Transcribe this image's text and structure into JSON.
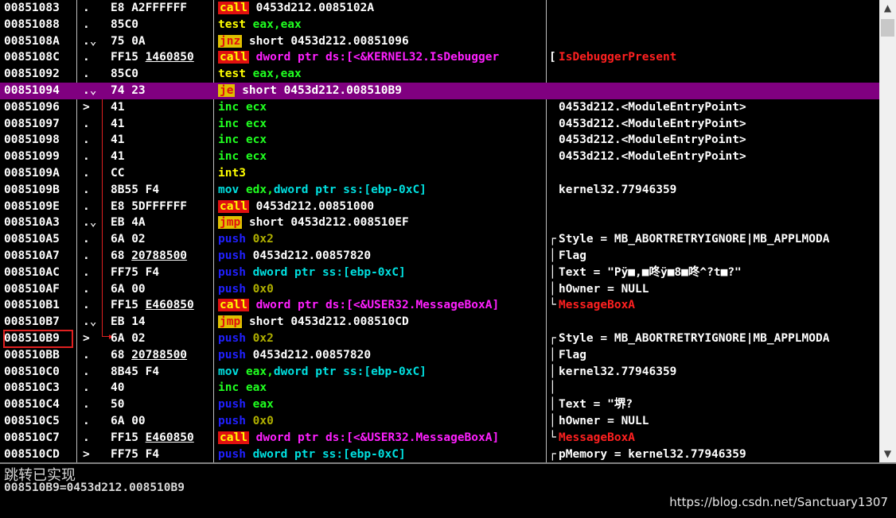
{
  "rows": [
    {
      "addr": "00851083",
      "mk": ".",
      "hex": "E8 A2FFFFFF",
      "mn": "call",
      "mnc": "call",
      "ops": [
        [
          "0453d212.0085102A",
          "white"
        ]
      ],
      "cmt": "",
      "br": ""
    },
    {
      "addr": "00851088",
      "mk": ".",
      "hex": "85C0",
      "mn": "test",
      "mnc": "test",
      "ops": [
        [
          "eax,eax",
          "green"
        ]
      ],
      "cmt": "",
      "br": ""
    },
    {
      "addr": "0085108A",
      "mk": ".⌄",
      "hex": "75 0A",
      "mn": "jnz",
      "mnc": "jcc",
      "ops": [
        [
          "short 0453d212.00851096",
          "white"
        ]
      ],
      "cmt": "",
      "br": ""
    },
    {
      "addr": "0085108C",
      "mk": ".",
      "hex": "FF15",
      "hexu": "1460850",
      "mn": "call",
      "mnc": "call",
      "ops": [
        [
          "dword ptr ds:[<&KERNEL32.IsDebugger",
          "magenta"
        ]
      ],
      "cmt": "IsDebuggerPresent",
      "cmtc": "red",
      "br": "["
    },
    {
      "addr": "00851092",
      "mk": ".",
      "hex": "85C0",
      "mn": "test",
      "mnc": "test",
      "ops": [
        [
          "eax,eax",
          "green"
        ]
      ],
      "cmt": "",
      "br": ""
    },
    {
      "addr": "00851094",
      "mk": ".⌄",
      "hex": "74 23",
      "mn": "je",
      "mnc": "jcc",
      "ops": [
        [
          "short 0453d212.008510B9",
          "white"
        ]
      ],
      "cmt": "",
      "br": "",
      "selected": true
    },
    {
      "addr": "00851096",
      "mk": ">",
      "hex": "41",
      "mn": "inc",
      "mnc": "inc",
      "ops": [
        [
          "ecx",
          "green"
        ]
      ],
      "cmt": "0453d212.<ModuleEntryPoint>",
      "br": ""
    },
    {
      "addr": "00851097",
      "mk": ".",
      "hex": "41",
      "mn": "inc",
      "mnc": "inc",
      "ops": [
        [
          "ecx",
          "green"
        ]
      ],
      "cmt": "0453d212.<ModuleEntryPoint>",
      "br": ""
    },
    {
      "addr": "00851098",
      "mk": ".",
      "hex": "41",
      "mn": "inc",
      "mnc": "inc",
      "ops": [
        [
          "ecx",
          "green"
        ]
      ],
      "cmt": "0453d212.<ModuleEntryPoint>",
      "br": ""
    },
    {
      "addr": "00851099",
      "mk": ".",
      "hex": "41",
      "mn": "inc",
      "mnc": "inc",
      "ops": [
        [
          "ecx",
          "green"
        ]
      ],
      "cmt": "0453d212.<ModuleEntryPoint>",
      "br": ""
    },
    {
      "addr": "0085109A",
      "mk": ".",
      "hex": "CC",
      "mn": "int3",
      "mnc": "int",
      "ops": [],
      "cmt": "",
      "br": ""
    },
    {
      "addr": "0085109B",
      "mk": ".",
      "hex": "8B55 F4",
      "mn": "mov",
      "mnc": "mov",
      "ops": [
        [
          "edx,",
          "green"
        ],
        [
          "dword ptr ss:[ebp-0xC]",
          "cyan"
        ]
      ],
      "cmt": "kernel32.77946359",
      "br": ""
    },
    {
      "addr": "0085109E",
      "mk": ".",
      "hex": "E8 5DFFFFFF",
      "mn": "call",
      "mnc": "call",
      "ops": [
        [
          "0453d212.00851000",
          "white"
        ]
      ],
      "cmt": "",
      "br": ""
    },
    {
      "addr": "008510A3",
      "mk": ".⌄",
      "hex": "EB 4A",
      "mn": "jmp",
      "mnc": "jcc",
      "ops": [
        [
          "short 0453d212.008510EF",
          "white"
        ]
      ],
      "cmt": "",
      "br": ""
    },
    {
      "addr": "008510A5",
      "mk": ".",
      "hex": "6A 02",
      "mn": "push",
      "mnc": "push",
      "ops": [
        [
          "0x2",
          "olive"
        ]
      ],
      "cmt": "Style = MB_ABORTRETRYIGNORE|MB_APPLMODA",
      "br": "┌"
    },
    {
      "addr": "008510A7",
      "mk": ".",
      "hex": "68",
      "hexu": "20788500",
      "mn": "push",
      "mnc": "push",
      "ops": [
        [
          "0453d212.00857820",
          "white"
        ]
      ],
      "cmt": "Flag",
      "br": "│"
    },
    {
      "addr": "008510AC",
      "mk": ".",
      "hex": "FF75 F4",
      "mn": "push",
      "mnc": "push",
      "ops": [
        [
          "dword ptr ss:[ebp-0xC]",
          "cyan"
        ]
      ],
      "cmt": "Text = \"Pÿ■,■咚ÿ■8■咚^?t■?\"",
      "br": "│"
    },
    {
      "addr": "008510AF",
      "mk": ".",
      "hex": "6A 00",
      "mn": "push",
      "mnc": "push",
      "ops": [
        [
          "0x0",
          "olive"
        ]
      ],
      "cmt": "hOwner = NULL",
      "br": "│"
    },
    {
      "addr": "008510B1",
      "mk": ".",
      "hex": "FF15",
      "hexu": "E460850",
      "mn": "call",
      "mnc": "call",
      "ops": [
        [
          "dword ptr ds:[<&USER32.MessageBoxA]",
          "magenta"
        ]
      ],
      "cmt": "MessageBoxA",
      "cmtc": "red",
      "br": "└"
    },
    {
      "addr": "008510B7",
      "mk": ".⌄",
      "hex": "EB 14",
      "mn": "jmp",
      "mnc": "jcc",
      "ops": [
        [
          "short 0453d212.008510CD",
          "white"
        ]
      ],
      "cmt": "",
      "br": ""
    },
    {
      "addr": "008510B9",
      "mk": ">",
      "hex": "6A 02",
      "mn": "push",
      "mnc": "push",
      "ops": [
        [
          "0x2",
          "olive"
        ]
      ],
      "cmt": "Style = MB_ABORTRETRYIGNORE|MB_APPLMODA",
      "br": "┌",
      "boxed": true
    },
    {
      "addr": "008510BB",
      "mk": ".",
      "hex": "68",
      "hexu": "20788500",
      "mn": "push",
      "mnc": "push",
      "ops": [
        [
          "0453d212.00857820",
          "white"
        ]
      ],
      "cmt": "Flag",
      "br": "│"
    },
    {
      "addr": "008510C0",
      "mk": ".",
      "hex": "8B45 F4",
      "mn": "mov",
      "mnc": "mov",
      "ops": [
        [
          "eax,",
          "green"
        ],
        [
          "dword ptr ss:[ebp-0xC]",
          "cyan"
        ]
      ],
      "cmt": "kernel32.77946359",
      "br": "│"
    },
    {
      "addr": "008510C3",
      "mk": ".",
      "hex": "40",
      "mn": "inc",
      "mnc": "inc",
      "ops": [
        [
          "eax",
          "green"
        ]
      ],
      "cmt": "",
      "br": "│"
    },
    {
      "addr": "008510C4",
      "mk": ".",
      "hex": "50",
      "mn": "push",
      "mnc": "push",
      "ops": [
        [
          "eax",
          "green"
        ]
      ],
      "cmt": "Text = \"堺?",
      "br": "│"
    },
    {
      "addr": "008510C5",
      "mk": ".",
      "hex": "6A 00",
      "mn": "push",
      "mnc": "push",
      "ops": [
        [
          "0x0",
          "olive"
        ]
      ],
      "cmt": "hOwner = NULL",
      "br": "│"
    },
    {
      "addr": "008510C7",
      "mk": ".",
      "hex": "FF15",
      "hexu": "E460850",
      "mn": "call",
      "mnc": "call",
      "ops": [
        [
          "dword ptr ds:[<&USER32.MessageBoxA]",
          "magenta"
        ]
      ],
      "cmt": "MessageBoxA",
      "cmtc": "red",
      "br": "└"
    },
    {
      "addr": "008510CD",
      "mk": ">",
      "hex": "FF75 F4",
      "mn": "push",
      "mnc": "push",
      "ops": [
        [
          "dword ptr ss:[ebp-0xC]",
          "cyan"
        ]
      ],
      "cmt": "pMemory = kernel32.77946359",
      "br": "┌"
    }
  ],
  "info": {
    "line1": "跳转已实现",
    "line2": "008510B9=0453d212.008510B9"
  },
  "watermark": "https://blog.csdn.net/Sanctuary1307",
  "icons": {
    "scroll_up": "up-arrow-icon",
    "scroll_down": "down-arrow-icon"
  },
  "colors": {
    "selected_row": "#800080",
    "call_bg": "#e01010",
    "jump_bg": "#e0c000"
  }
}
